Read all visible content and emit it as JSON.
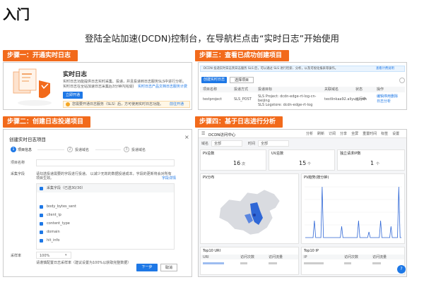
{
  "header": {
    "title": "入门",
    "subtitle": "登陆全站加速(DCDN)控制台，在导航栏点击“实时日志”开始使用"
  },
  "steps": {
    "s1": "步骤一：开通实时日志",
    "s2": "步骤二：创建日志投递项目",
    "s3": "步骤三：查看已成功创建项目",
    "s4": "步骤四：基于日志进行分析"
  },
  "panel1": {
    "heading": "实时日志",
    "desc1": "实时日志功能提供日志实时采集、投递，并且投递到日志服务SLS中进行分析。",
    "desc2": "实时日志在全站加速日志采集后3分钟内完成投递，加速业务决策。",
    "link": "实时日志产品文档",
    "link2": "日志服务计费",
    "button": "立即开通",
    "notice": "您需要开通日志服务（SLS）后，方可使用实时日志功能。",
    "notice_link": "前往开通"
  },
  "panel2": {
    "title": "创建实时日志项目",
    "wizard": [
      "项目信息",
      "投递域名",
      "投递域名"
    ],
    "fields": {
      "project_name": "项目名称",
      "collect_fields": "采集字段",
      "sampling": "采样率"
    },
    "hint": "请勾选投递需要的字段进行投递。 以减少无效的数据投递成本，字段的更新将会对所有项目生效。",
    "hint_link": "字段详情",
    "table_header": "采集字段（已选30/30）",
    "field_options": [
      "body_bytes_sent",
      "client_ip",
      "content_type",
      "domain",
      "hit_info"
    ],
    "sampling_value": "100%",
    "sampling_hint": "请谨慎配置日志采样率（建议设置为100%以获取完整数据）",
    "next_button": "下一步",
    "cancel_button": "取消"
  },
  "panel3": {
    "notice": "DCDN 投递实时日志到日志服务 SLS 后，可以通过 SLS 进行检索、分析，以及可视化报表等操作。",
    "notice_link": "查看计费说明",
    "create_button": "创建实时日志",
    "select_label": "选择项目",
    "columns": [
      "项目名称",
      "投递方式",
      "投递目标",
      "关联域名",
      "状态",
      "操作"
    ],
    "row": {
      "name": "testproject",
      "type": "SLS_POST",
      "target1": "SLS Project: dcdn-edge-rt-log-cn-beijing",
      "target2": "SLS Logstore: dcdn-edge-rt-log",
      "domain": "testlinkaa92.aliyun.com",
      "status": "运行中",
      "actions": [
        "编辑",
        "停用",
        "删除",
        "日志分析"
      ]
    }
  },
  "panel4": {
    "app_title": "DCDN访问中心",
    "toolbar": [
      "分析",
      "刷新",
      "订阅",
      "分享",
      "全屏",
      "重置时间",
      "标签",
      "设置"
    ],
    "filter_labels": [
      "域名",
      "时间"
    ],
    "filter_values": [
      "全部",
      "全部"
    ],
    "kpis": [
      {
        "label": "PV总数",
        "value": "16",
        "unit": "次"
      },
      {
        "label": "UV总数",
        "value": "15",
        "unit": "个"
      },
      {
        "label": "独立请求IP数",
        "value": "1",
        "unit": "个"
      }
    ],
    "map_title": "PV分布",
    "trend_title": "PV趋势(按分钟)",
    "table1_title": "Top10 URI",
    "table1_columns": [
      "URI",
      "访问次数",
      "访问流量"
    ],
    "table2_title": "Top10 IP",
    "table2_columns": [
      "IP",
      "访问次数",
      "访问流量"
    ],
    "trend_values": [
      0,
      0,
      0,
      0,
      0,
      0,
      0,
      3,
      0,
      0,
      0,
      0,
      0,
      9,
      0,
      0,
      0,
      0,
      0,
      0,
      0,
      0,
      0,
      0,
      0,
      0,
      0,
      0,
      2,
      0,
      0,
      0,
      0,
      0,
      0,
      0,
      0,
      0,
      0,
      0,
      0,
      3,
      0,
      0,
      0,
      0,
      0,
      0,
      0,
      1,
      0,
      0,
      0,
      0,
      0,
      0,
      0,
      0,
      3,
      0,
      0,
      0,
      0,
      0,
      0,
      0,
      2,
      0,
      0,
      0,
      0,
      0,
      9,
      0,
      0
    ]
  },
  "colors": {
    "accent": "#f26a1b",
    "primary": "#1e78e6"
  }
}
